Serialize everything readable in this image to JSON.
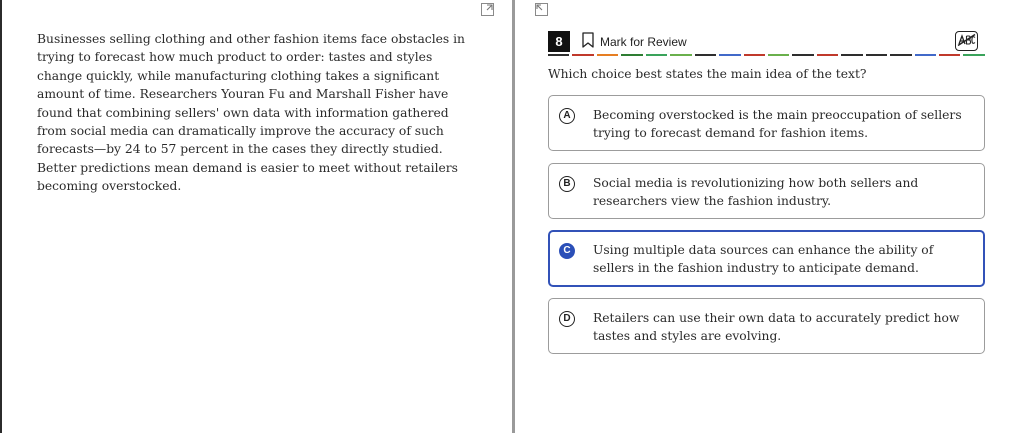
{
  "passage": {
    "text": "Businesses selling clothing and other fashion items face obstacles in trying to forecast how much product to order: tastes and styles change quickly, while manufacturing clothing takes a significant amount of time. Researchers Youran Fu and Marshall Fisher have found that combining sellers' own data with information gathered from social media can dramatically improve the accuracy of such forecasts—by 24 to 57 percent in the cases they directly studied. Better predictions mean demand is easier to meet without retailers becoming overstocked."
  },
  "header": {
    "question_number": "8",
    "mark_for_review_label": "Mark for Review",
    "abc_icon": "strikethrough-abc-icon",
    "dash_colors": [
      "#2e2e2e",
      "#c0392b",
      "#e67e22",
      "#2e7d32",
      "#3aa35b",
      "#6ab04c",
      "#2e2e2e",
      "#4169c9",
      "#c0392b",
      "#6ab04c",
      "#2e2e2e",
      "#c0392b",
      "#2e2e2e",
      "#2e2e2e",
      "#2e2e2e",
      "#4169c9",
      "#c0392b",
      "#3aa35b"
    ]
  },
  "question": {
    "text": "Which choice best states the main idea of the text?"
  },
  "choices": [
    {
      "letter": "A",
      "text": "Becoming overstocked is the main preoccupation of sellers trying to forecast demand for fashion items.",
      "selected": false
    },
    {
      "letter": "B",
      "text": "Social media is revolutionizing how both sellers and researchers view the fashion industry.",
      "selected": false
    },
    {
      "letter": "C",
      "text": "Using multiple data sources can enhance the ability of sellers in the fashion industry to anticipate demand.",
      "selected": true
    },
    {
      "letter": "D",
      "text": "Retailers can use their own data to accurately predict how tastes and styles are evolving.",
      "selected": false
    }
  ],
  "colors": {
    "accent": "#2b4fb8",
    "divider": "#9a9a9a"
  }
}
